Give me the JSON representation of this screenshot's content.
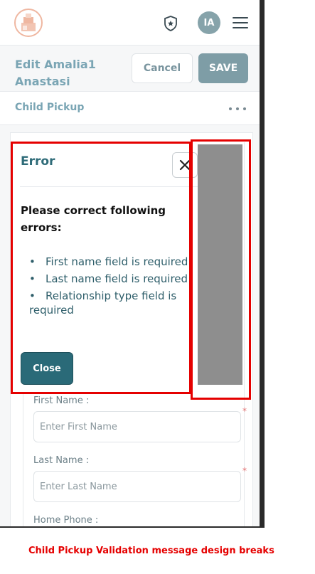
{
  "header": {
    "avatar_initials": "IA",
    "logo_icon": "building-blocks-logo",
    "badge_icon": "shield-star-icon",
    "menu_icon": "hamburger-icon"
  },
  "toolbar": {
    "title": "Edit Amalia1 Anastasi",
    "cancel_label": "Cancel",
    "save_label": "SAVE"
  },
  "section": {
    "title": "Child Pickup",
    "more_icon": "more-dots-icon"
  },
  "modal": {
    "title": "Error",
    "heading": "Please correct following errors:",
    "errors": [
      "First name field is required",
      "Last name field is required",
      "Relationship type field is required"
    ],
    "close_label": "Close"
  },
  "form": {
    "first_name_label": "First Name :",
    "first_name_placeholder": "Enter First Name",
    "last_name_label": "Last Name :",
    "last_name_placeholder": "Enter Last Name",
    "home_phone_label": "Home Phone :",
    "required_marker": "*"
  },
  "caption": "Child Pickup Validation message design breaks",
  "colors": {
    "accent": "#2a6a78",
    "annotation": "#e50000"
  }
}
